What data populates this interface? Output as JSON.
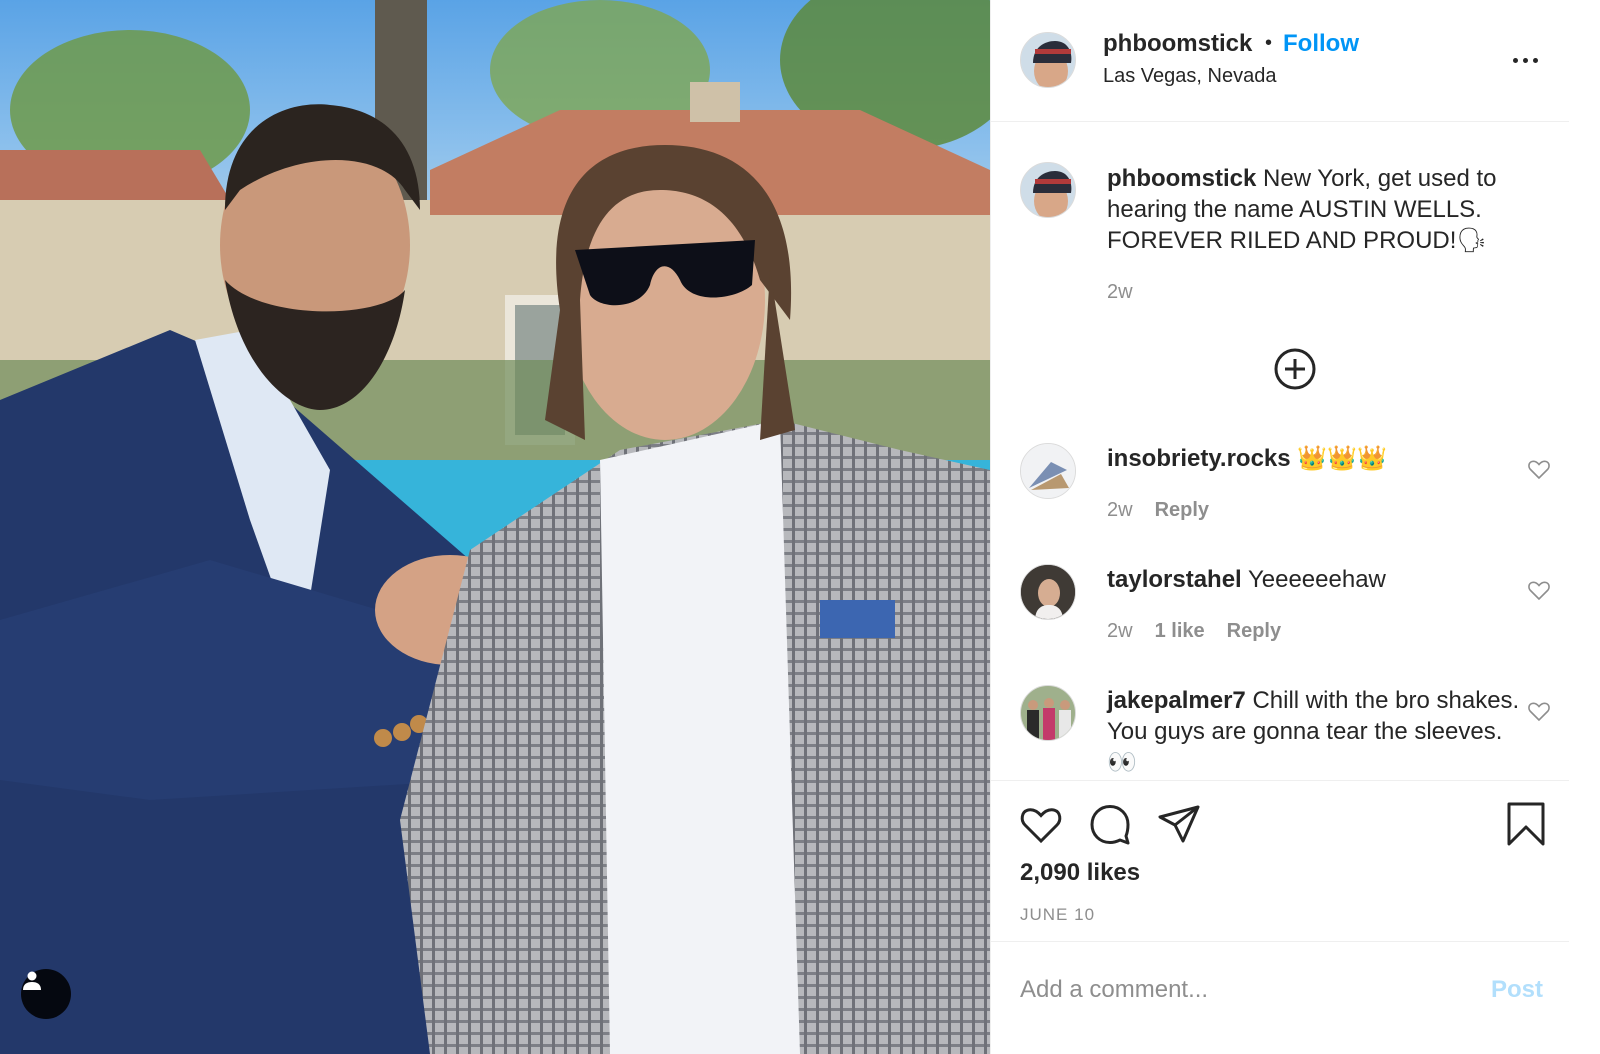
{
  "post": {
    "author": "phboomstick",
    "follow_label": "Follow",
    "separator": "•",
    "location": "Las Vegas, Nevada",
    "more_icon": "more-horizontal-icon"
  },
  "caption": {
    "username": "phboomstick",
    "text": "New York, get used to hearing the name AUSTIN WELLS. FOREVER RILED AND PROUD!",
    "emoji": "🗣",
    "time": "2w"
  },
  "comments": [
    {
      "username": "insobriety.rocks",
      "text": "",
      "emoji": "👑👑👑",
      "time": "2w",
      "likes": "",
      "reply": "Reply"
    },
    {
      "username": "taylorstahel",
      "text": "Yeeeeeehaw",
      "emoji": "",
      "time": "2w",
      "likes": "1 like",
      "reply": "Reply"
    },
    {
      "username": "jakepalmer7",
      "text": "Chill with the bro shakes. You guys are gonna tear the sleeves.",
      "emoji": "👀",
      "time": "",
      "likes": "",
      "reply": ""
    }
  ],
  "stats": {
    "likes": "2,090 likes",
    "date": "JUNE 10"
  },
  "composer": {
    "placeholder": "Add a comment...",
    "post_label": "Post"
  },
  "colors": {
    "link": "#0095f6",
    "post_disabled": "#b2dffc",
    "muted": "#8e8e8e",
    "text": "#262626"
  }
}
